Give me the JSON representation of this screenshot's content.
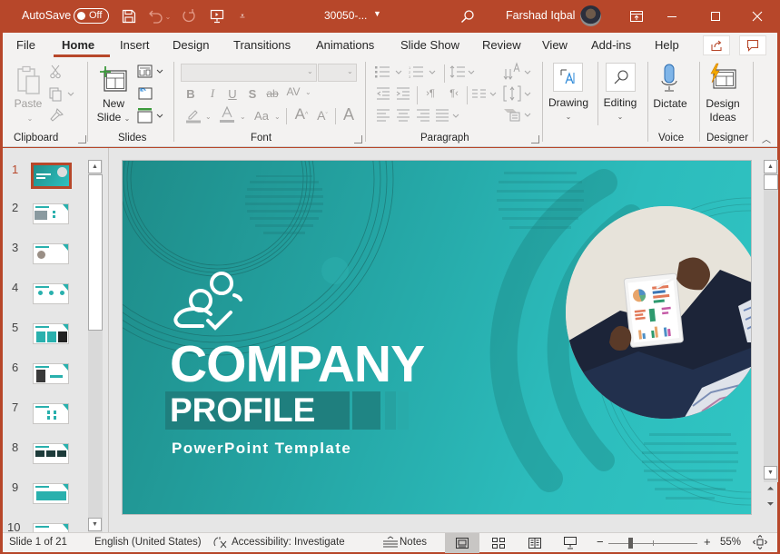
{
  "titlebar": {
    "autosave_label": "AutoSave",
    "autosave_state": "Off",
    "doc_title": "30050-...",
    "user_name": "Farshad Iqbal",
    "icons": [
      "save-icon",
      "undo-icon",
      "redo-icon",
      "present-from-beginning-icon",
      "customize-qat-icon",
      "search-icon",
      "ribbon-display-options-icon",
      "minimize-icon",
      "maximize-icon",
      "close-icon"
    ]
  },
  "tabs": [
    {
      "label": "File"
    },
    {
      "label": "Home",
      "active": true
    },
    {
      "label": "Insert"
    },
    {
      "label": "Design"
    },
    {
      "label": "Transitions"
    },
    {
      "label": "Animations"
    },
    {
      "label": "Slide Show"
    },
    {
      "label": "Review"
    },
    {
      "label": "View"
    },
    {
      "label": "Add-ins"
    },
    {
      "label": "Help"
    }
  ],
  "ribbon": {
    "clipboard": {
      "label": "Clipboard",
      "paste": "Paste"
    },
    "slides": {
      "label": "Slides",
      "new_slide_1": "New",
      "new_slide_2": "Slide"
    },
    "font": {
      "label": "Font",
      "font_name": "",
      "font_size": "",
      "bold": "B",
      "italic": "I",
      "underline": "U",
      "shadow": "S",
      "strike": "ab",
      "spacing": "AV",
      "case": "Aa",
      "grow": "A",
      "shrink": "A",
      "clear": "A"
    },
    "paragraph": {
      "label": "Paragraph"
    },
    "drawing": {
      "label": "Drawing"
    },
    "editing": {
      "label": "Editing"
    },
    "voice": {
      "label": "Voice",
      "dictate": "Dictate"
    },
    "designer": {
      "label": "Designer",
      "ideas_1": "Design",
      "ideas_2": "Ideas"
    }
  },
  "thumbnails": [
    {
      "num": "1",
      "active": true
    },
    {
      "num": "2"
    },
    {
      "num": "3"
    },
    {
      "num": "4"
    },
    {
      "num": "5"
    },
    {
      "num": "6"
    },
    {
      "num": "7"
    },
    {
      "num": "8"
    },
    {
      "num": "9"
    },
    {
      "num": "10"
    }
  ],
  "slide": {
    "title": "COMPANY",
    "subtitle": "PROFILE",
    "tagline": "PowerPoint Template",
    "colors": {
      "teal_dark": "#1e8c89",
      "teal_light": "#30c5c3"
    }
  },
  "statusbar": {
    "slide_info": "Slide 1 of 21",
    "language": "English (United States)",
    "accessibility": "Accessibility: Investigate",
    "notes": "Notes",
    "zoom_minus": "−",
    "zoom_plus": "+",
    "zoom_level": "55%",
    "zoom_percent": 55
  },
  "colors": {
    "accent": "#b7472a",
    "ribbon_bg": "#f3f2f1",
    "workspace_bg": "#e6e6e6"
  }
}
